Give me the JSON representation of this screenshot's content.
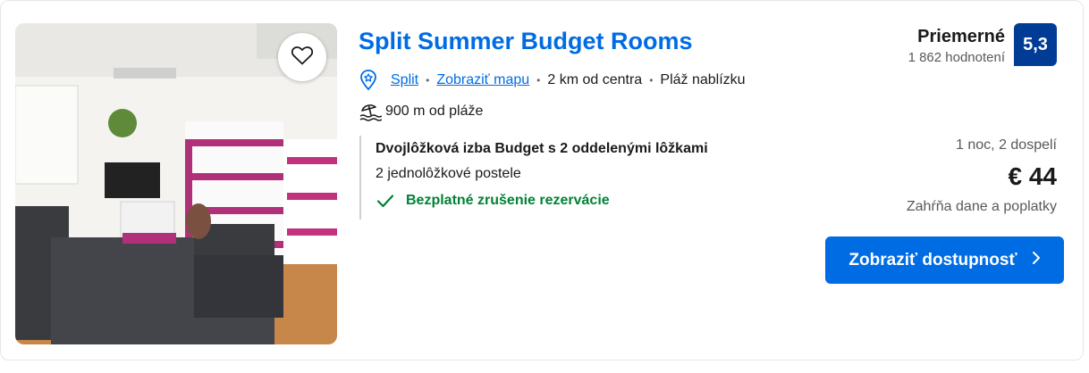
{
  "property": {
    "name": "Split Summer Budget Rooms",
    "location": {
      "city": "Split",
      "map_link": "Zobraziť mapu",
      "distance": "2 km od centra",
      "beach_note": "Pláž nablízku"
    },
    "beach_distance": "900 m od pláže"
  },
  "review": {
    "word": "Priemerné",
    "count": "1 862 hodnotení",
    "score": "5,3",
    "score_color": "#003b95"
  },
  "room": {
    "title": "Dvojlôžková izba Budget s 2 oddelenými lôžkami",
    "beds": "2 jednolôžkové postele",
    "cancellation": "Bezplatné zrušenie rezervácie"
  },
  "pricing": {
    "stay": "1 noc, 2 dospelí",
    "price": "€ 44",
    "taxes": "Zahŕňa dane a poplatky"
  },
  "cta": {
    "label": "Zobraziť dostupnosť"
  },
  "colors": {
    "link": "#006ce4",
    "green": "#008234",
    "button": "#006ce4"
  },
  "icons": [
    "heart-icon",
    "map-pin-icon",
    "beach-icon",
    "checkmark-icon",
    "chevron-right-icon"
  ]
}
